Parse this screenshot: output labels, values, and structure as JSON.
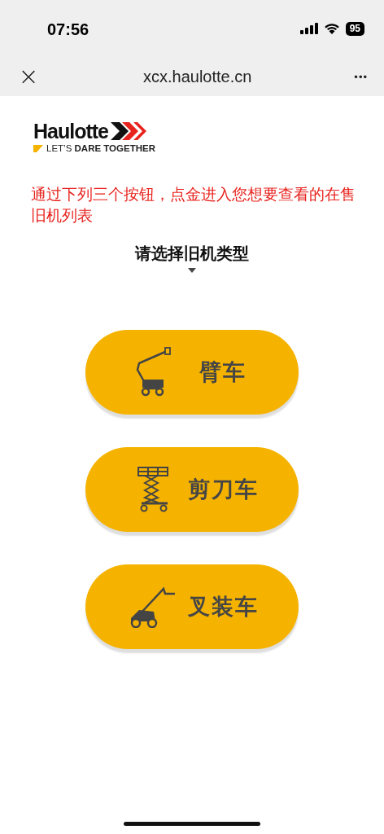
{
  "status_bar": {
    "time": "07:56",
    "battery": "95"
  },
  "browser_bar": {
    "close": "×",
    "url": "xcx.haulotte.cn",
    "more": "•••"
  },
  "logo": {
    "name": "Haulotte",
    "tagline": "LET’S **DARE TOGETHER**"
  },
  "notice": "通过下列三个按钮，点金进入您想要查看的在售旧机列表",
  "heading": "请选择旧机类型",
  "buttons": [
    {
      "kind": "boom",
      "label": "臂车"
    },
    {
      "kind": "scissor",
      "label": "剪刀车"
    },
    {
      "kind": "telehandler",
      "label": "叉装车"
    }
  ]
}
